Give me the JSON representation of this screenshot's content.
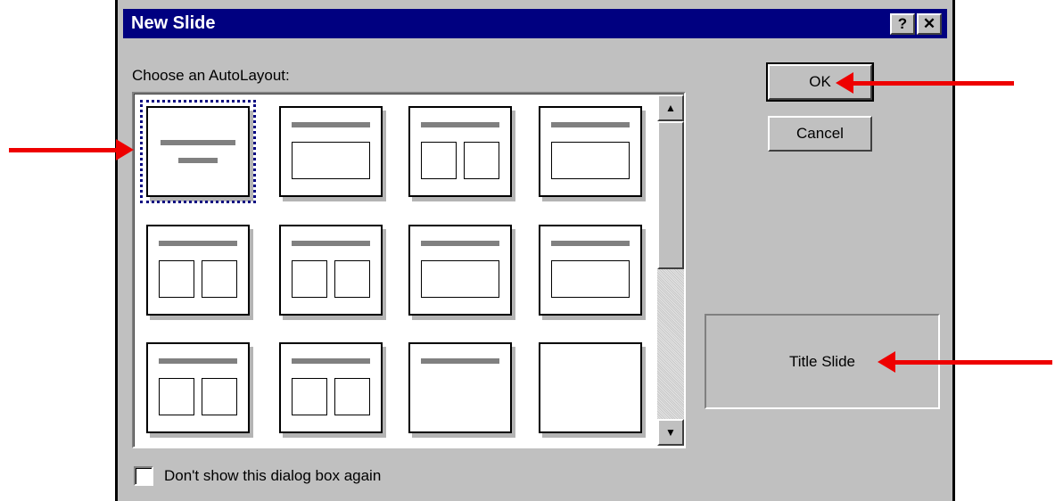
{
  "dialog": {
    "title": "New Slide",
    "help_button": "?",
    "close_button": "✕",
    "choose_label": "Choose an AutoLayout:",
    "ok_label": "OK",
    "cancel_label": "Cancel",
    "preview_name": "Title Slide",
    "checkbox_label": "Don't show this dialog box again",
    "checkbox_checked": false,
    "selected_layout": "Title Slide"
  },
  "colors": {
    "titlebar": "#000080",
    "face": "#c0c0c0",
    "arrow": "#ee0000"
  }
}
